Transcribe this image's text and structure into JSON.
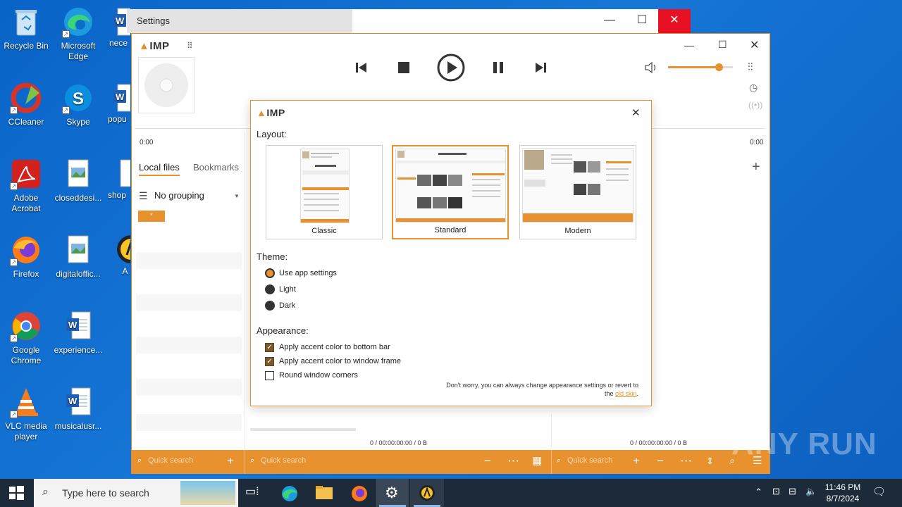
{
  "desktop": {
    "icons": [
      {
        "label": "Recycle Bin"
      },
      {
        "label": "Microsoft Edge"
      },
      {
        "label": "nece"
      },
      {
        "label": "CCleaner"
      },
      {
        "label": "Skype"
      },
      {
        "label": "popu"
      },
      {
        "label": "Adobe Acrobat"
      },
      {
        "label": "closeddesi..."
      },
      {
        "label": "shop"
      },
      {
        "label": "Firefox"
      },
      {
        "label": "digitaloffic..."
      },
      {
        "label": "A"
      },
      {
        "label": "Google Chrome"
      },
      {
        "label": "experience..."
      },
      {
        "label": "VLC media player"
      },
      {
        "label": "musicalusr..."
      }
    ]
  },
  "settings_window": {
    "title": "Settings"
  },
  "aimp": {
    "logo": "IMP",
    "time_left": "0:00",
    "time_right": "0:00",
    "tabs": [
      {
        "label": "Local files"
      },
      {
        "label": "Bookmarks"
      }
    ],
    "grouping": "No grouping",
    "status_mid": "0 / 00:00:00:00 / 0 B",
    "status_right": "0 / 00:00:00:00 / 0 B",
    "quick_search": [
      "Quick search",
      "Quick search",
      "Quick search"
    ],
    "volume_fraction": 0.78
  },
  "dialog": {
    "logo": "IMP",
    "layout_heading": "Layout:",
    "layouts": [
      {
        "label": "Classic"
      },
      {
        "label": "Standard"
      },
      {
        "label": "Modern"
      }
    ],
    "selected_layout": "Standard",
    "theme_heading": "Theme:",
    "themes": [
      {
        "label": "Use app settings"
      },
      {
        "label": "Light"
      },
      {
        "label": "Dark"
      }
    ],
    "selected_theme": "Use app settings",
    "appearance_heading": "Appearance:",
    "options": [
      {
        "label": "Apply accent color to bottom bar",
        "checked": true
      },
      {
        "label": "Apply accent color to window frame",
        "checked": true
      },
      {
        "label": "Round window corners",
        "checked": false
      }
    ],
    "note_line1": "Don't worry, you can always change appearance settings or revert to",
    "note_line2": "the",
    "note_link": "old skin",
    "note_end": "."
  },
  "taskbar": {
    "search_placeholder": "Type here to search",
    "time": "11:46 PM",
    "date": "8/7/2024"
  },
  "watermark": "ANY RUN",
  "colors": {
    "accent": "#e8912f",
    "desktop": "#1676d6",
    "close_red": "#e81123"
  }
}
